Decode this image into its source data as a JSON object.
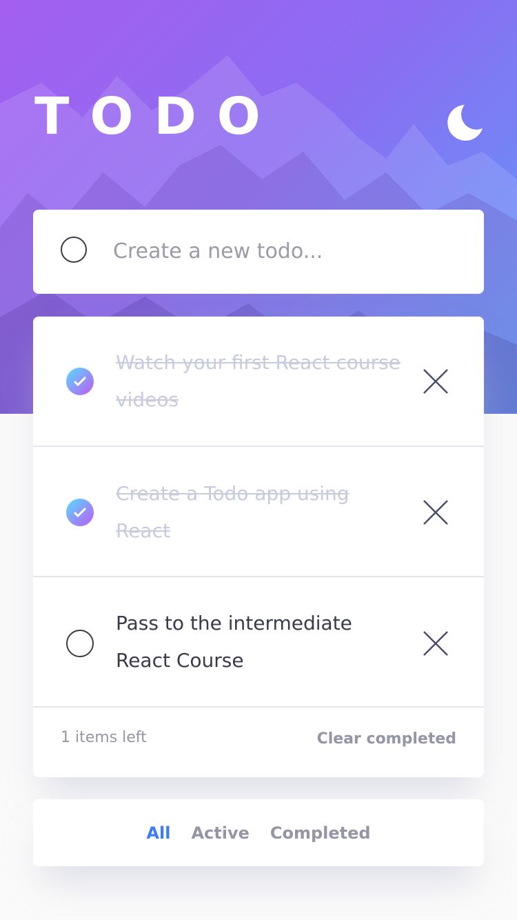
{
  "header": {
    "title": "TODO",
    "theme_icon": "moon-icon"
  },
  "new_todo": {
    "placeholder": "Create a new todo..."
  },
  "todos": [
    {
      "text": "Watch your first React course videos",
      "completed": true
    },
    {
      "text": "Create a Todo app using React",
      "completed": true
    },
    {
      "text": "Pass to the intermediate React Course",
      "completed": false
    }
  ],
  "footer": {
    "items_left": "1 items left",
    "clear_label": "Clear completed"
  },
  "filters": {
    "all": "All",
    "active": "Active",
    "completed": "Completed",
    "selected": "All"
  },
  "colors": {
    "accent": "#3a7cfd",
    "check_gradient_start": "#55ddff",
    "check_gradient_end": "#c058f3",
    "hero_start": "#a45ff0",
    "hero_end": "#5c9df7"
  }
}
